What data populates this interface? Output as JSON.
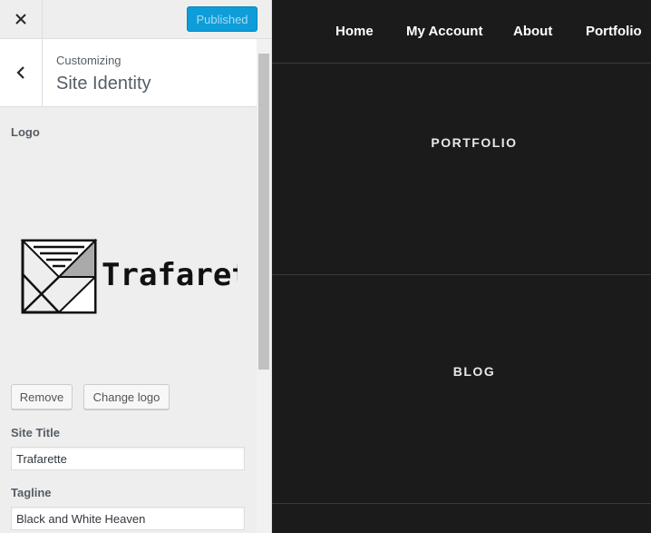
{
  "topbar": {
    "publish_label": "Published"
  },
  "section": {
    "subtitle": "Customizing",
    "title": "Site Identity"
  },
  "logo": {
    "label": "Logo",
    "brand_text": "Trafarette",
    "remove_label": "Remove",
    "change_label": "Change logo"
  },
  "site_title": {
    "label": "Site Title",
    "value": "Trafarette"
  },
  "tagline": {
    "label": "Tagline",
    "value": "Black and White Heaven"
  },
  "preview": {
    "nav": [
      "Home",
      "My Account",
      "About",
      "Portfolio"
    ],
    "sections": [
      "PORTFOLIO",
      "BLOG"
    ]
  },
  "colors": {
    "accent": "#0e9dd8",
    "preview_bg": "#1b1b1b",
    "panel_bg": "#eeeeee"
  }
}
